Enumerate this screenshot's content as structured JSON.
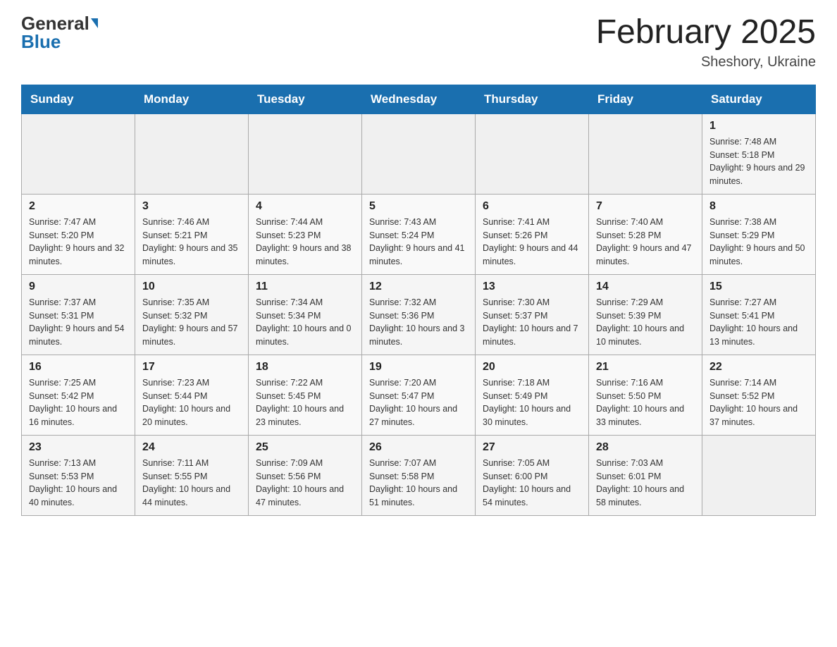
{
  "header": {
    "logo": {
      "general": "General",
      "blue": "Blue"
    },
    "title": "February 2025",
    "location": "Sheshory, Ukraine"
  },
  "calendar": {
    "days_of_week": [
      "Sunday",
      "Monday",
      "Tuesday",
      "Wednesday",
      "Thursday",
      "Friday",
      "Saturday"
    ],
    "weeks": [
      [
        {
          "day": "",
          "info": ""
        },
        {
          "day": "",
          "info": ""
        },
        {
          "day": "",
          "info": ""
        },
        {
          "day": "",
          "info": ""
        },
        {
          "day": "",
          "info": ""
        },
        {
          "day": "",
          "info": ""
        },
        {
          "day": "1",
          "info": "Sunrise: 7:48 AM\nSunset: 5:18 PM\nDaylight: 9 hours and 29 minutes."
        }
      ],
      [
        {
          "day": "2",
          "info": "Sunrise: 7:47 AM\nSunset: 5:20 PM\nDaylight: 9 hours and 32 minutes."
        },
        {
          "day": "3",
          "info": "Sunrise: 7:46 AM\nSunset: 5:21 PM\nDaylight: 9 hours and 35 minutes."
        },
        {
          "day": "4",
          "info": "Sunrise: 7:44 AM\nSunset: 5:23 PM\nDaylight: 9 hours and 38 minutes."
        },
        {
          "day": "5",
          "info": "Sunrise: 7:43 AM\nSunset: 5:24 PM\nDaylight: 9 hours and 41 minutes."
        },
        {
          "day": "6",
          "info": "Sunrise: 7:41 AM\nSunset: 5:26 PM\nDaylight: 9 hours and 44 minutes."
        },
        {
          "day": "7",
          "info": "Sunrise: 7:40 AM\nSunset: 5:28 PM\nDaylight: 9 hours and 47 minutes."
        },
        {
          "day": "8",
          "info": "Sunrise: 7:38 AM\nSunset: 5:29 PM\nDaylight: 9 hours and 50 minutes."
        }
      ],
      [
        {
          "day": "9",
          "info": "Sunrise: 7:37 AM\nSunset: 5:31 PM\nDaylight: 9 hours and 54 minutes."
        },
        {
          "day": "10",
          "info": "Sunrise: 7:35 AM\nSunset: 5:32 PM\nDaylight: 9 hours and 57 minutes."
        },
        {
          "day": "11",
          "info": "Sunrise: 7:34 AM\nSunset: 5:34 PM\nDaylight: 10 hours and 0 minutes."
        },
        {
          "day": "12",
          "info": "Sunrise: 7:32 AM\nSunset: 5:36 PM\nDaylight: 10 hours and 3 minutes."
        },
        {
          "day": "13",
          "info": "Sunrise: 7:30 AM\nSunset: 5:37 PM\nDaylight: 10 hours and 7 minutes."
        },
        {
          "day": "14",
          "info": "Sunrise: 7:29 AM\nSunset: 5:39 PM\nDaylight: 10 hours and 10 minutes."
        },
        {
          "day": "15",
          "info": "Sunrise: 7:27 AM\nSunset: 5:41 PM\nDaylight: 10 hours and 13 minutes."
        }
      ],
      [
        {
          "day": "16",
          "info": "Sunrise: 7:25 AM\nSunset: 5:42 PM\nDaylight: 10 hours and 16 minutes."
        },
        {
          "day": "17",
          "info": "Sunrise: 7:23 AM\nSunset: 5:44 PM\nDaylight: 10 hours and 20 minutes."
        },
        {
          "day": "18",
          "info": "Sunrise: 7:22 AM\nSunset: 5:45 PM\nDaylight: 10 hours and 23 minutes."
        },
        {
          "day": "19",
          "info": "Sunrise: 7:20 AM\nSunset: 5:47 PM\nDaylight: 10 hours and 27 minutes."
        },
        {
          "day": "20",
          "info": "Sunrise: 7:18 AM\nSunset: 5:49 PM\nDaylight: 10 hours and 30 minutes."
        },
        {
          "day": "21",
          "info": "Sunrise: 7:16 AM\nSunset: 5:50 PM\nDaylight: 10 hours and 33 minutes."
        },
        {
          "day": "22",
          "info": "Sunrise: 7:14 AM\nSunset: 5:52 PM\nDaylight: 10 hours and 37 minutes."
        }
      ],
      [
        {
          "day": "23",
          "info": "Sunrise: 7:13 AM\nSunset: 5:53 PM\nDaylight: 10 hours and 40 minutes."
        },
        {
          "day": "24",
          "info": "Sunrise: 7:11 AM\nSunset: 5:55 PM\nDaylight: 10 hours and 44 minutes."
        },
        {
          "day": "25",
          "info": "Sunrise: 7:09 AM\nSunset: 5:56 PM\nDaylight: 10 hours and 47 minutes."
        },
        {
          "day": "26",
          "info": "Sunrise: 7:07 AM\nSunset: 5:58 PM\nDaylight: 10 hours and 51 minutes."
        },
        {
          "day": "27",
          "info": "Sunrise: 7:05 AM\nSunset: 6:00 PM\nDaylight: 10 hours and 54 minutes."
        },
        {
          "day": "28",
          "info": "Sunrise: 7:03 AM\nSunset: 6:01 PM\nDaylight: 10 hours and 58 minutes."
        },
        {
          "day": "",
          "info": ""
        }
      ]
    ]
  }
}
